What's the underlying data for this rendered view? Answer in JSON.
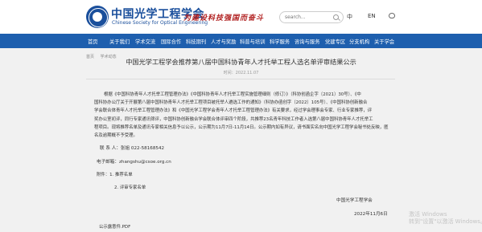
{
  "header": {
    "logo_cn": "中国光学工程学会",
    "logo_en": "Chinese Society for Optical Engineering",
    "slogan": "为建设科技强国而奋斗",
    "search_placeholder": "search...",
    "lang_cn": "中",
    "lang_en": "EN"
  },
  "nav": {
    "items": [
      "首页",
      "关于我们",
      "学术交流",
      "国际合作",
      "科技期刊",
      "人才与奖励",
      "科普与培训",
      "科学服务",
      "咨询与服务",
      "党建专区",
      "分支机构",
      "关于学会"
    ]
  },
  "breadcrumb": [
    "首页",
    "学术动态"
  ],
  "article": {
    "title": "中国光学工程学会推荐第八届中国科协青年人才托举工程人选名单评审结果公示",
    "time": "时间：2022.11.07",
    "para_lines": [
      "根据《中国科协青年人才托举工程管理办法》《中国科协青年人才托举工程实施管理细则（修订）》（科协创函企字〔2021〕30号）、《中",
      "国科协办公厅关于开展第八届中国科协青年人才托举工程项目被托举人遴选工作的通知》（科协办函创字〔2022〕105号）、《中国科协创新融合",
      "学会联合体青年人才托举工程管理办法》和《中国光学工程学会青年人才托举工程管理办法》有关要求，经过学会理事会专家、行业专家推荐，评",
      "奖办公室初评，同行专家通讯筛评，中国科协创新融合学会联合体评审四个阶段，共推荐23名青年科技工作者入选第八届中国科协青年人才托举工",
      "程项目。现将推荐名单及通讯专家相关信息予以公示，公示期为11月7日-11月14日。公示期内如有异议，请书面实名向中国光学工程学会秘书处反映，匿",
      "名及逾期概不予受理。"
    ],
    "contact": "联 系 人：张姐  022-58168542",
    "email": "电子邮箱：zhangshu@csoe.org.cn",
    "attachments_label": "附件：1. 推荐名单",
    "attachment_2": "2. 评审专家名单",
    "org": "中国光学工程学会",
    "date": "2022年11月6日",
    "file": "公示露意件.PDF"
  },
  "watermark": {
    "line1": "激活 Windows",
    "line2": "转到\"设置\"以激活 Windows。"
  },
  "colors": {
    "brand_blue": "#1a4f9c",
    "nav_blue": "#1e5fae",
    "slogan_red": "#b22222",
    "page_bg": "#f1f1f1"
  }
}
